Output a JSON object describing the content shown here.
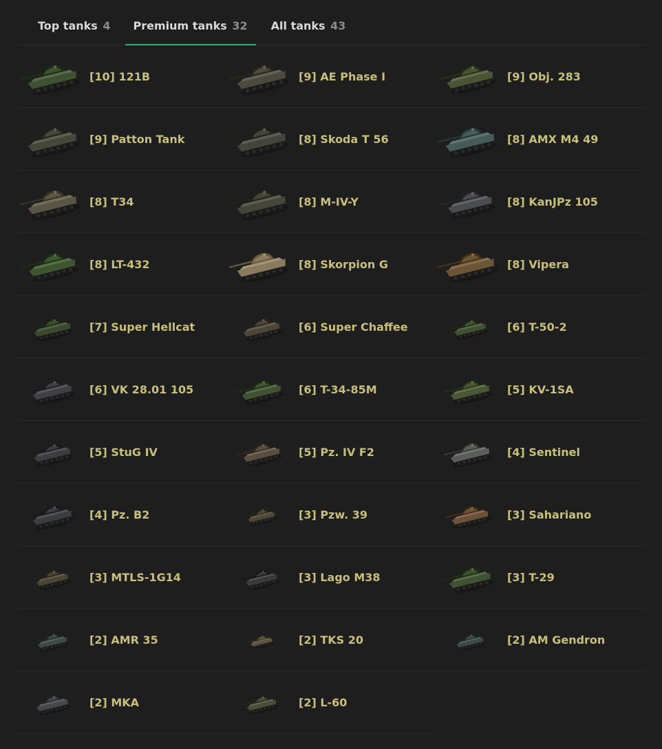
{
  "tabs": [
    {
      "label": "Top tanks",
      "count": "4",
      "active": false
    },
    {
      "label": "Premium tanks",
      "count": "32",
      "active": true
    },
    {
      "label": "All tanks",
      "count": "43",
      "active": false
    }
  ],
  "tanks": [
    {
      "name": "[10] 121B",
      "color": "#3e5233",
      "scale": 1.0
    },
    {
      "name": "[9] AE Phase I",
      "color": "#4b4a3c",
      "scale": 1.0
    },
    {
      "name": "[9] Obj. 283",
      "color": "#4a5435",
      "scale": 0.95
    },
    {
      "name": "[9] Patton Tank",
      "color": "#45473a",
      "scale": 1.0
    },
    {
      "name": "[8] Skoda T 56",
      "color": "#43453b",
      "scale": 1.0
    },
    {
      "name": "[8] AMX M4 49",
      "color": "#465a58",
      "scale": 1.0
    },
    {
      "name": "[8] T34",
      "color": "#5a5545",
      "scale": 1.0
    },
    {
      "name": "[8] M-IV-Y",
      "color": "#45453a",
      "scale": 1.0
    },
    {
      "name": "[8] KanJPz 105",
      "color": "#4a4c4f",
      "scale": 0.9
    },
    {
      "name": "[8] LT-432",
      "color": "#3f5530",
      "scale": 0.95
    },
    {
      "name": "[8] Skorpion G",
      "color": "#8a7a5e",
      "scale": 1.0
    },
    {
      "name": "[8] Vipera",
      "color": "#6b5536",
      "scale": 1.0
    },
    {
      "name": "[7] Super Hellcat",
      "color": "#3b4a2e",
      "scale": 0.75
    },
    {
      "name": "[6] Super Chaffee",
      "color": "#4c4638",
      "scale": 0.75
    },
    {
      "name": "[6] T-50-2",
      "color": "#3e5232",
      "scale": 0.65
    },
    {
      "name": "[6] VK 28.01 105",
      "color": "#3e4044",
      "scale": 0.8
    },
    {
      "name": "[6] T-34-85M",
      "color": "#3f5232",
      "scale": 0.8
    },
    {
      "name": "[5] KV-1SA",
      "color": "#4a5734",
      "scale": 0.8
    },
    {
      "name": "[5] StuG IV",
      "color": "#3c3d40",
      "scale": 0.75
    },
    {
      "name": "[5] Pz. IV F2",
      "color": "#5a4e40",
      "scale": 0.75
    },
    {
      "name": "[4] Sentinel",
      "color": "#5a5d5a",
      "scale": 0.8
    },
    {
      "name": "[4] Pz. B2",
      "color": "#3b3c40",
      "scale": 0.8
    },
    {
      "name": "[3] Pzw. 39",
      "color": "#4d4838",
      "scale": 0.55
    },
    {
      "name": "[3] Sahariano",
      "color": "#6b5238",
      "scale": 0.75
    },
    {
      "name": "[3] MTLS-1G14",
      "color": "#4a4535",
      "scale": 0.65
    },
    {
      "name": "[3] Lago M38",
      "color": "#38393a",
      "scale": 0.65
    },
    {
      "name": "[3] T-29",
      "color": "#3f5232",
      "scale": 0.85
    },
    {
      "name": "[2] AMR 35",
      "color": "#3d4a45",
      "scale": 0.6
    },
    {
      "name": "[2] TKS 20",
      "color": "#5a5440",
      "scale": 0.45
    },
    {
      "name": "[2] AM Gendron",
      "color": "#3d4a4a",
      "scale": 0.55
    },
    {
      "name": "[2] MKA",
      "color": "#45474a",
      "scale": 0.65
    },
    {
      "name": "[2] L-60",
      "color": "#4a4e38",
      "scale": 0.6
    }
  ]
}
